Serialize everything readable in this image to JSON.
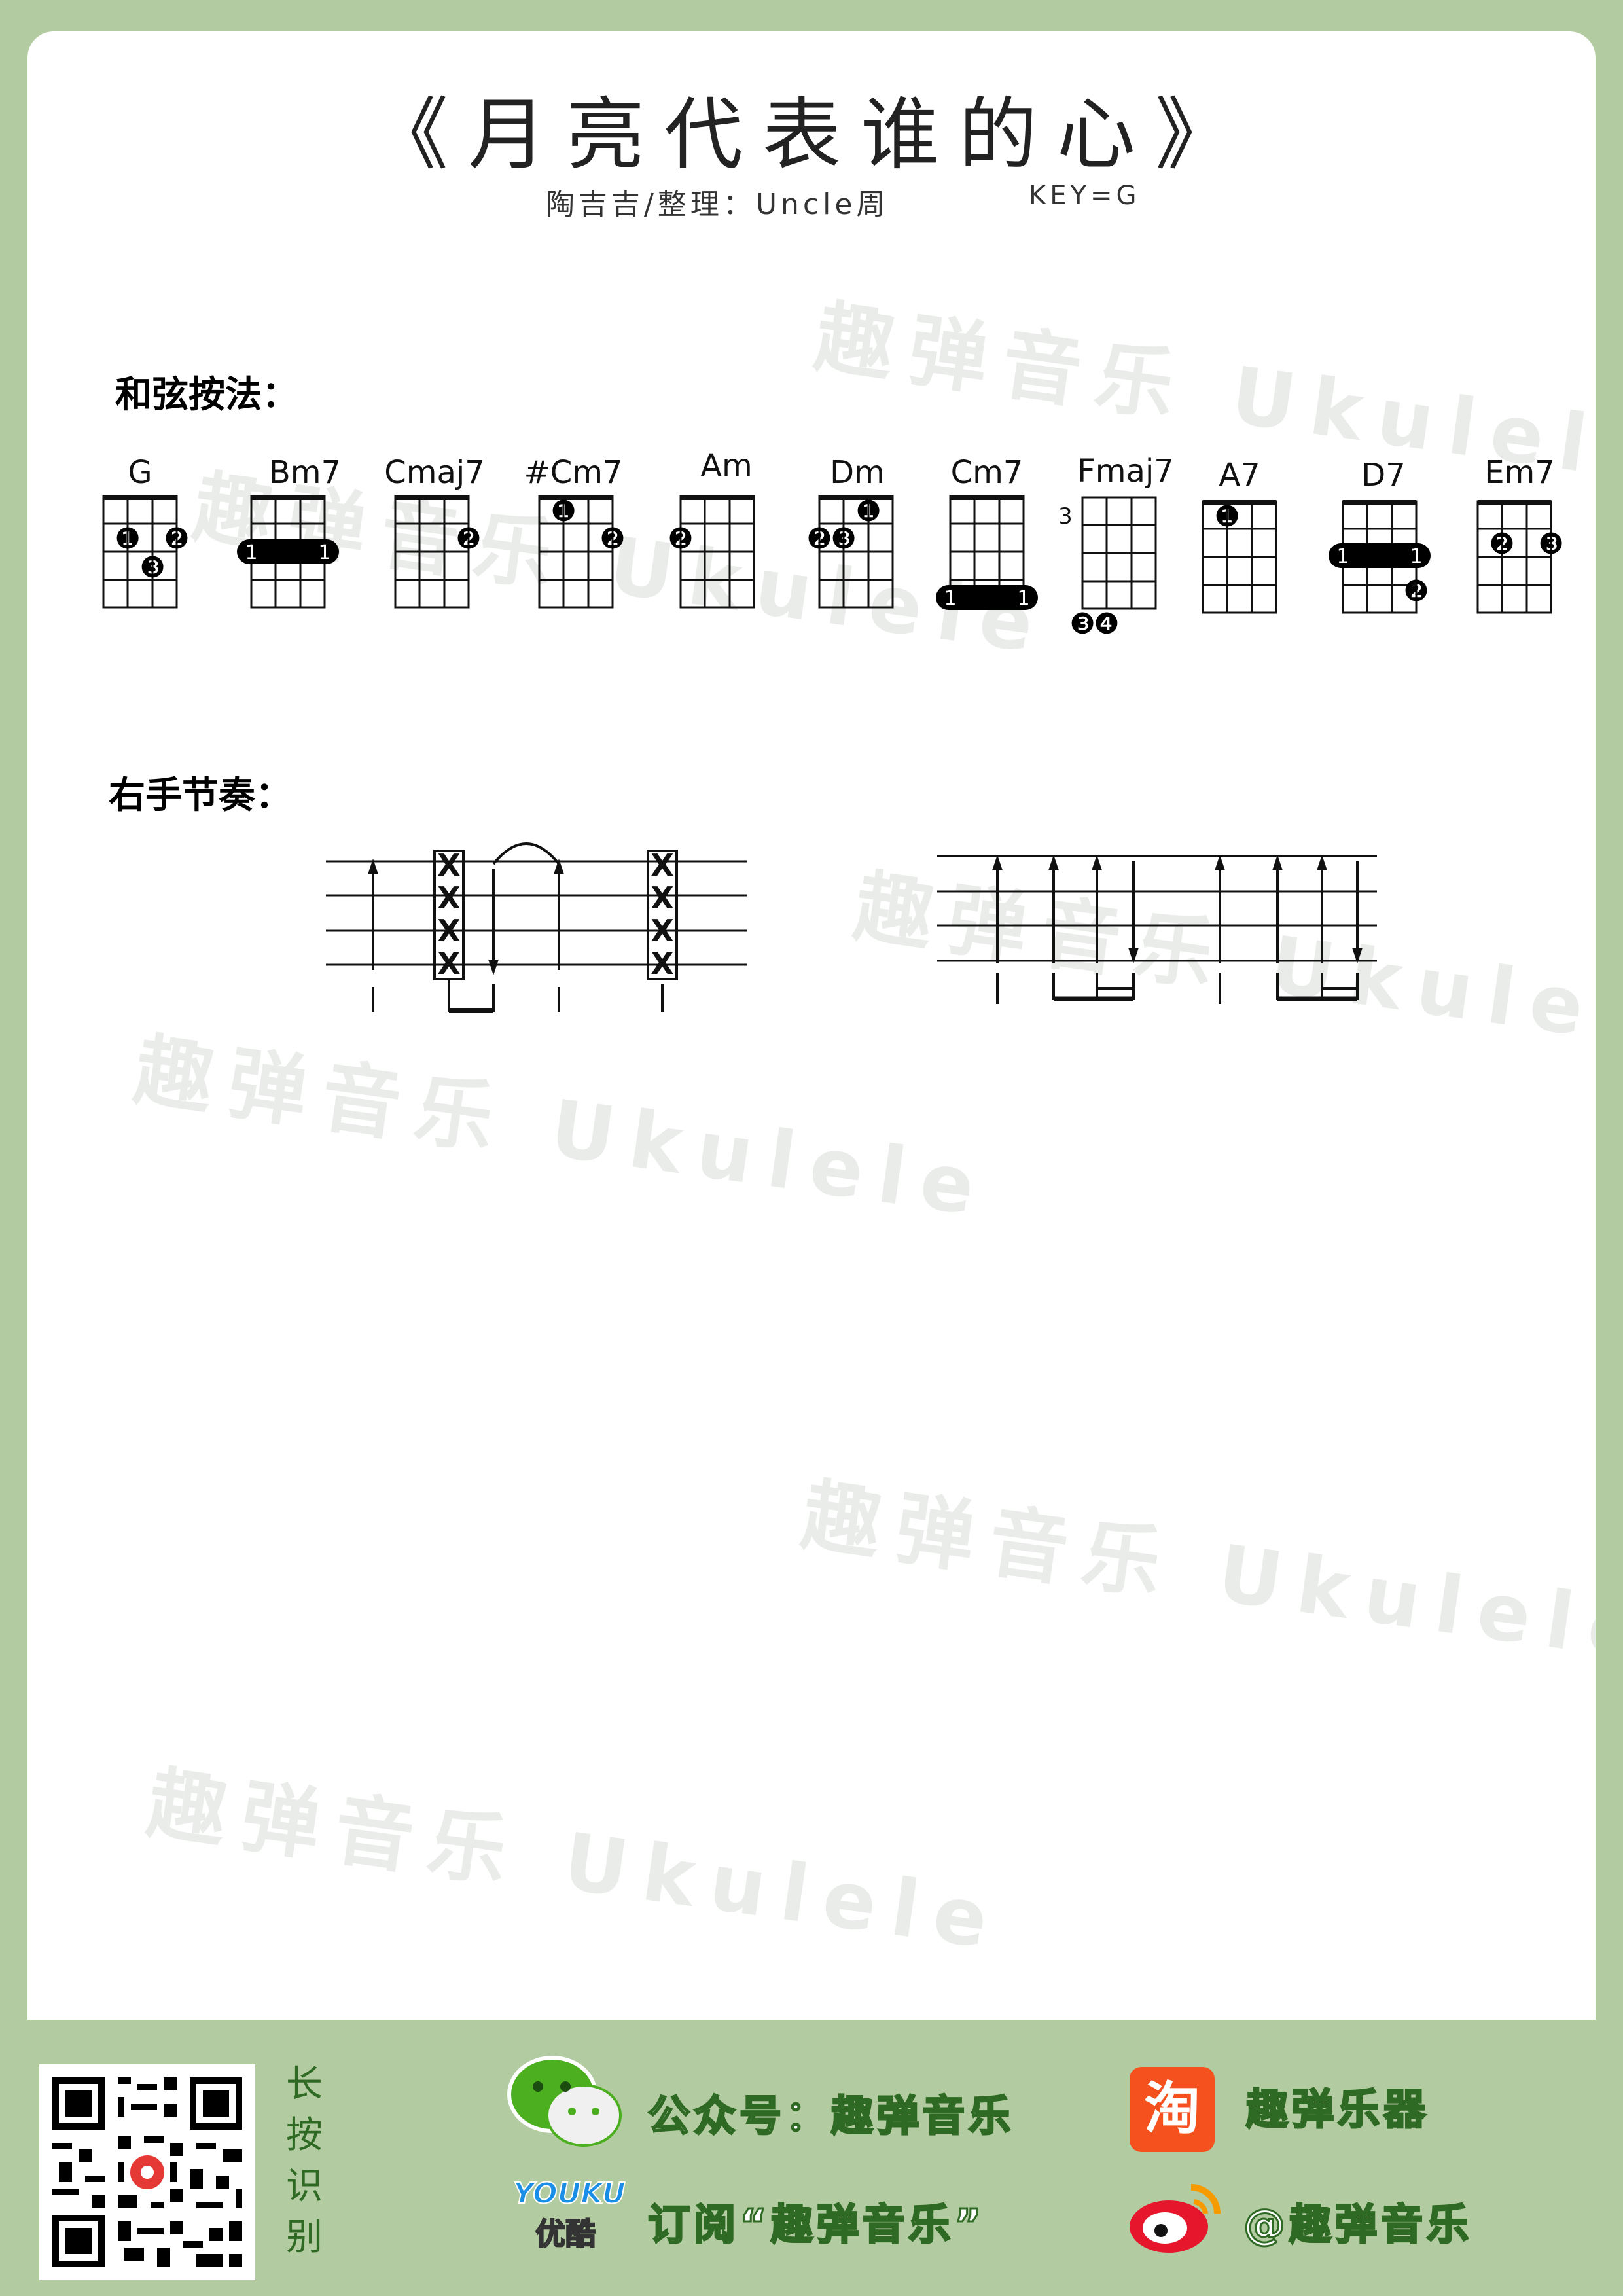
{
  "title": "《月亮代表谁的心》",
  "subtitle": "陶吉吉/整理：Uncle周",
  "key": "KEY=G",
  "sections": {
    "chords": "和弦按法：",
    "rhythm": "右手节奏："
  },
  "watermark": "趣弹音乐 Ukulele",
  "chords": [
    {
      "name": "G",
      "fret": "",
      "dots": [
        [
          "❶"
        ],
        [
          "❷"
        ],
        [
          "❸"
        ]
      ]
    },
    {
      "name": "Bm7",
      "fret": "",
      "barre": "1"
    },
    {
      "name": "Cmaj7",
      "fret": "",
      "dots": [
        [
          "❷"
        ]
      ]
    },
    {
      "name": "#Cm7",
      "fret": "",
      "dots": [
        [
          "❶"
        ],
        [
          "❷"
        ]
      ]
    },
    {
      "name": "Am",
      "fret": "",
      "dots": [
        [
          "❷"
        ]
      ]
    },
    {
      "name": "Dm",
      "fret": "",
      "dots": [
        [
          "❶"
        ],
        [
          "❷"
        ],
        [
          "❸"
        ]
      ]
    },
    {
      "name": "Cm7",
      "fret": "",
      "barre": "1"
    },
    {
      "name": "Fmaj7",
      "fret": "3",
      "dots": [
        [
          "❸"
        ],
        [
          "❹"
        ]
      ]
    },
    {
      "name": "A7",
      "fret": "",
      "dots": [
        [
          "❶"
        ]
      ]
    },
    {
      "name": "D7",
      "fret": "",
      "barre": "1",
      "dots": [
        [
          "❷"
        ]
      ]
    },
    {
      "name": "Em7",
      "fret": "",
      "dots": [
        [
          "❷"
        ],
        [
          "❸"
        ]
      ]
    }
  ],
  "rhythm_marks": {
    "mute": "X"
  },
  "footer": {
    "scan": [
      "长",
      "按",
      "识",
      "别"
    ],
    "wechat": "公众号：趣弹音乐",
    "youku_logo": "YOUKU",
    "youku_cn": "优酷",
    "subscribe": "订阅“趣弹音乐”",
    "taobao_logo": "淘",
    "taobao": "趣弹乐器",
    "weibo": "@趣弹音乐",
    "colors": {
      "green": "#2e6a23",
      "bg": "#b2cba0",
      "taobao": "#f4511e",
      "weibo": "#e6162d"
    }
  }
}
